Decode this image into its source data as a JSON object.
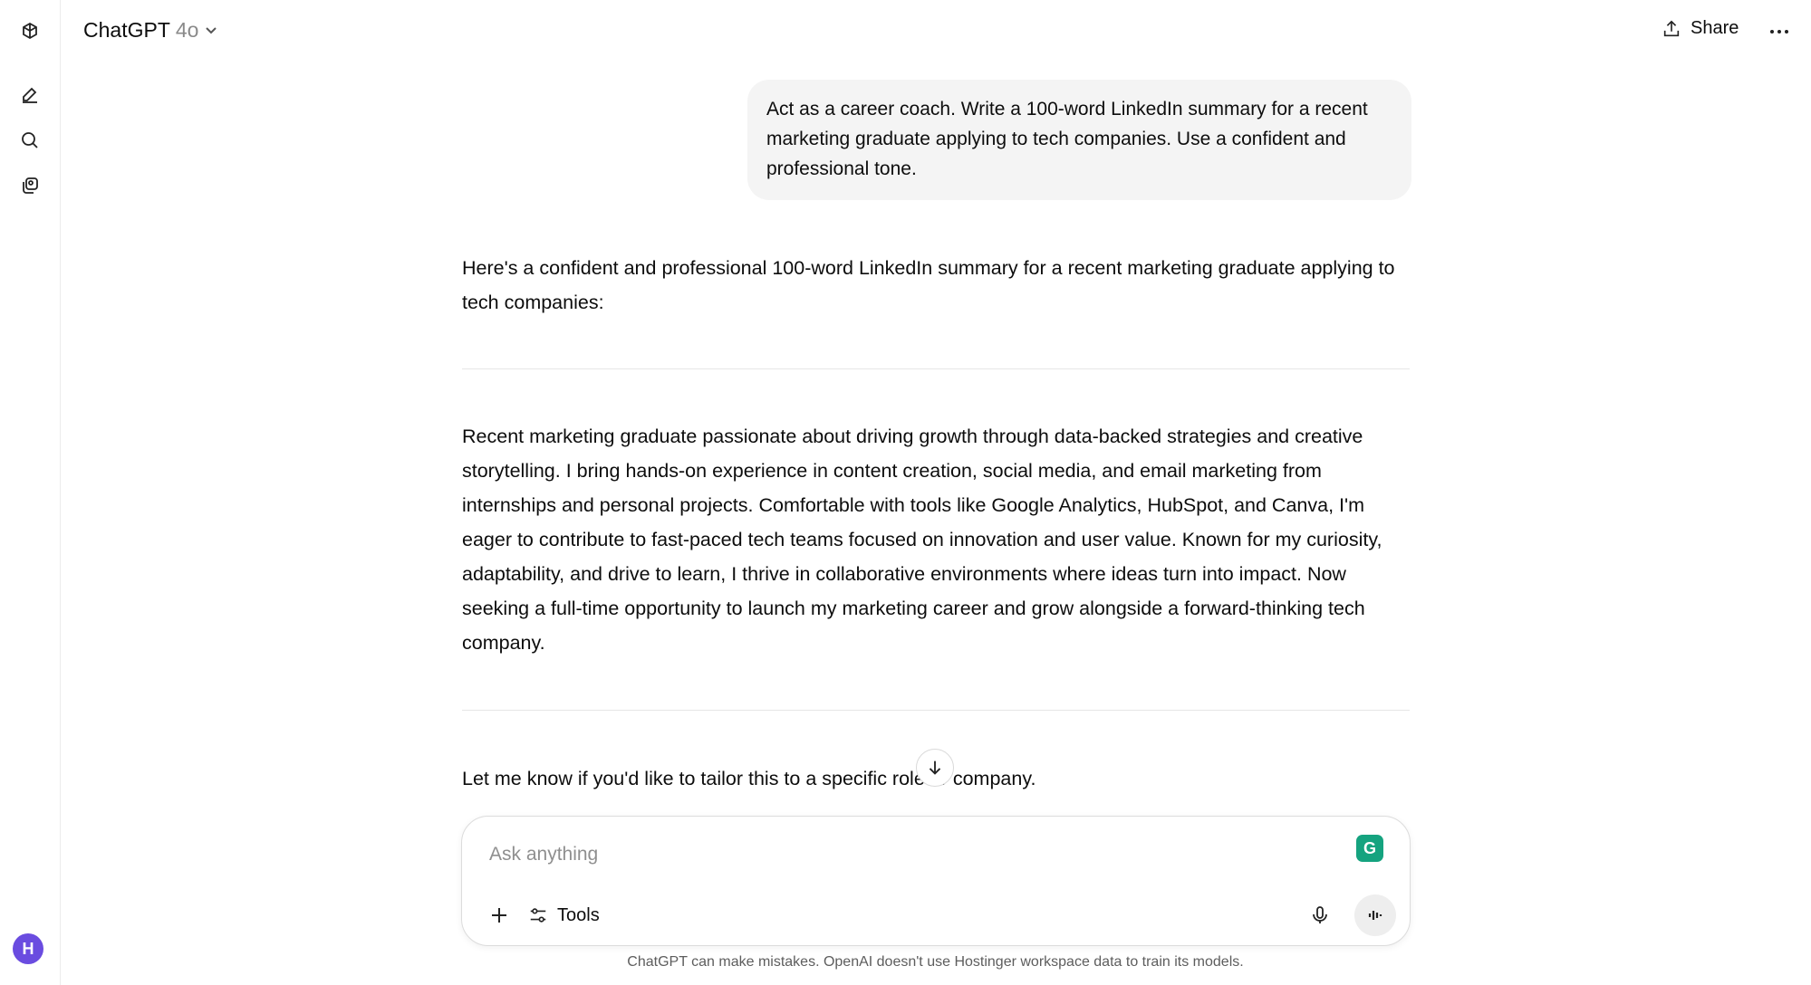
{
  "header": {
    "title": "ChatGPT",
    "model": "4o",
    "share_label": "Share"
  },
  "sidebar": {
    "icons": [
      "openai-logo-icon",
      "new-chat-icon",
      "search-icon",
      "library-icon"
    ],
    "avatar_initial": "H"
  },
  "conversation": {
    "user_message": "Act as a career coach. Write a 100-word LinkedIn summary for a recent marketing graduate applying to tech companies. Use a confident and professional tone.",
    "assistant_intro": "Here's a confident and professional 100-word LinkedIn summary for a recent marketing graduate applying to tech companies:",
    "assistant_summary": "Recent marketing graduate passionate about driving growth through data-backed strategies and creative storytelling. I bring hands-on experience in content creation, social media, and email marketing from internships and personal projects. Comfortable with tools like Google Analytics, HubSpot, and Canva, I'm eager to contribute to fast-paced tech teams focused on innovation and user value. Known for my curiosity, adaptability, and drive to learn, I thrive in collaborative environments where ideas turn into impact. Now seeking a full-time opportunity to launch my marketing career and grow alongside a forward-thinking tech company.",
    "assistant_outro": "Let me know if you'd like to tailor this to a specific role or company."
  },
  "composer": {
    "placeholder": "Ask anything",
    "tools_label": "Tools",
    "grammarly_letter": "G"
  },
  "footer": {
    "disclaimer": "ChatGPT can make mistakes. OpenAI doesn't use Hostinger workspace data to train its models."
  }
}
